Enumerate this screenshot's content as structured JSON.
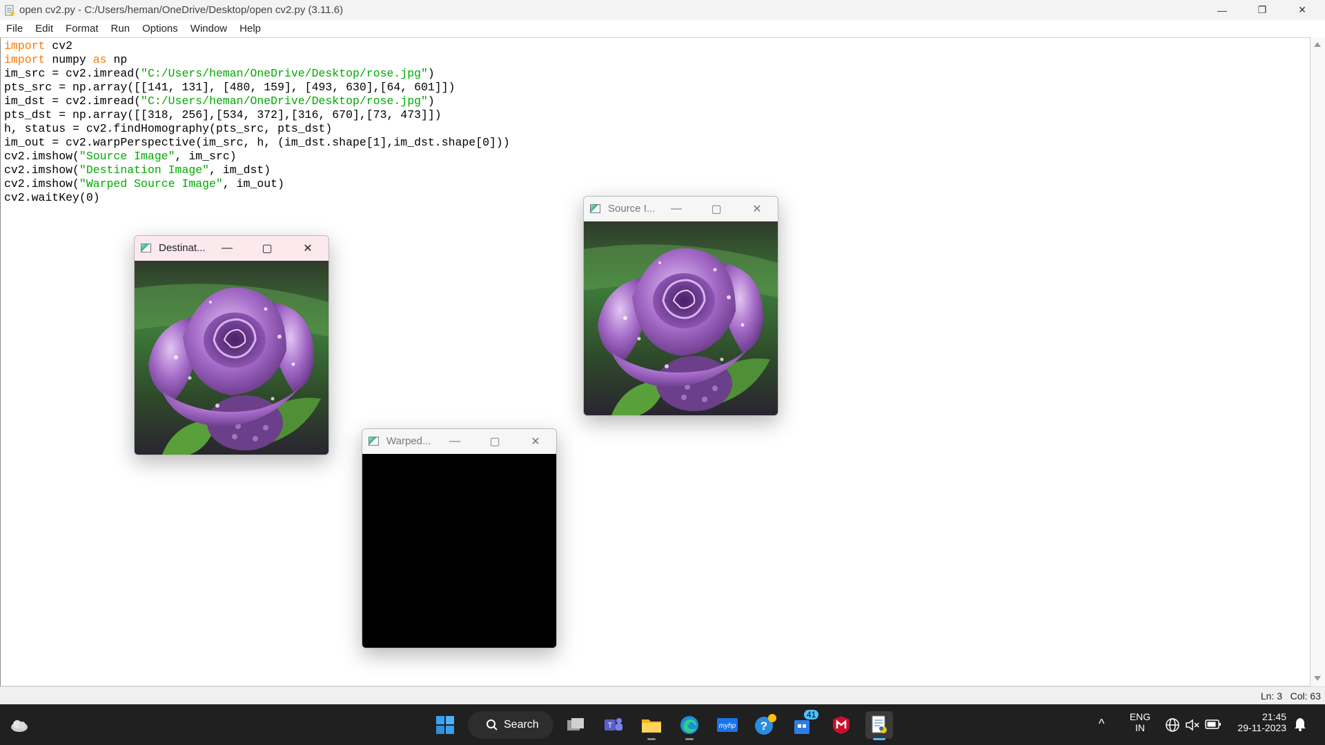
{
  "window": {
    "title": "open cv2.py - C:/Users/heman/OneDrive/Desktop/open cv2.py (3.11.6)",
    "minimize": "—",
    "restore": "❐",
    "close": "✕"
  },
  "menu": [
    "File",
    "Edit",
    "Format",
    "Run",
    "Options",
    "Window",
    "Help"
  ],
  "code": {
    "l1_kw": "import",
    "l1_rest": " cv2",
    "l2_kw": "import",
    "l2_mid": " numpy ",
    "l2_kw2": "as",
    "l2_rest": " np",
    "l3_pre": "im_src = cv2.imread(",
    "l3_str": "\"C:/Users/heman/OneDrive/Desktop/rose.jpg\"",
    "l3_post": ")",
    "l4": "pts_src = np.array([[141, 131], [480, 159], [493, 630],[64, 601]])",
    "l5_pre": "im_dst = cv2.imread(",
    "l5_str": "\"C:/Users/heman/OneDrive/Desktop/rose.jpg\"",
    "l5_post": ")",
    "l6": "pts_dst = np.array([[318, 256],[534, 372],[316, 670],[73, 473]])",
    "l7": "h, status = cv2.findHomography(pts_src, pts_dst)",
    "l8": "im_out = cv2.warpPerspective(im_src, h, (im_dst.shape[1],im_dst.shape[0]))",
    "l9_pre": "cv2.imshow(",
    "l9_str": "\"Source Image\"",
    "l9_post": ", im_src)",
    "l10_pre": "cv2.imshow(",
    "l10_str": "\"Destination Image\"",
    "l10_post": ", im_dst)",
    "l11_pre": "cv2.imshow(",
    "l11_str": "\"Warped Source Image\"",
    "l11_post": ", im_out)",
    "l12": "cv2.waitKey(0)"
  },
  "windows": {
    "destination": "Destinat...",
    "warped": "Warped...",
    "source": "Source I...",
    "min": "—",
    "max": "▢",
    "close": "✕"
  },
  "status": {
    "ln": "Ln: 3",
    "col": "Col: 63"
  },
  "taskbar": {
    "search": "Search",
    "lang1": "ENG",
    "lang2": "IN",
    "time": "21:45",
    "date": "29-11-2023",
    "badge": "41",
    "caret": "^"
  },
  "colors": {
    "keyword": "#ff7700",
    "string": "#00aa00",
    "taskbar": "#202020"
  }
}
